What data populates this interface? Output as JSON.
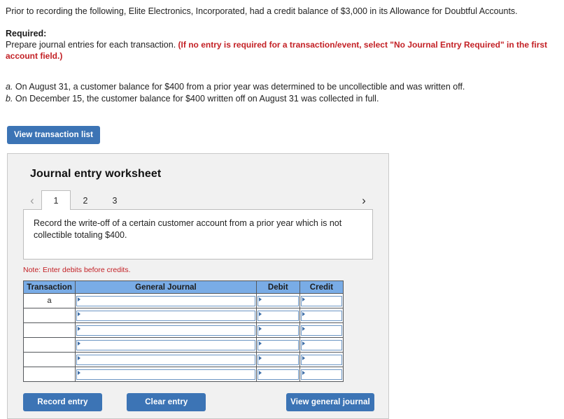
{
  "problem": {
    "intro": "Prior to recording the following, Elite Electronics, Incorporated, had a credit balance of $3,000 in its Allowance for Doubtful Accounts.",
    "required_label": "Required:",
    "required_text": "Prepare journal entries for each transaction.",
    "required_note": "(If no entry is required for a transaction/event, select \"No Journal Entry Required\" in the first account field.)",
    "transactions": [
      {
        "key": "a.",
        "text": "On August 31, a customer balance for $400 from a prior year was determined to be uncollectible and was written off."
      },
      {
        "key": "b.",
        "text": "On December 15, the customer balance for $400 written off on August 31 was collected in full."
      }
    ]
  },
  "actions": {
    "view_transaction_list": "View transaction list"
  },
  "worksheet": {
    "title": "Journal entry worksheet",
    "nav": {
      "prev_icon": "chevron-left-icon",
      "next_icon": "chevron-right-icon",
      "prev_glyph": "‹",
      "next_glyph": "›"
    },
    "tabs": [
      {
        "label": "1",
        "active": true
      },
      {
        "label": "2",
        "active": false
      },
      {
        "label": "3",
        "active": false
      }
    ],
    "instruction": "Record the write-off of a certain customer account from a prior year which is not collectible totaling $400.",
    "note": "Note: Enter debits before credits.",
    "table": {
      "headers": [
        "Transaction",
        "General Journal",
        "Debit",
        "Credit"
      ],
      "rows": [
        {
          "transaction": "a",
          "general_journal": "",
          "debit": "",
          "credit": ""
        },
        {
          "transaction": "",
          "general_journal": "",
          "debit": "",
          "credit": ""
        },
        {
          "transaction": "",
          "general_journal": "",
          "debit": "",
          "credit": ""
        },
        {
          "transaction": "",
          "general_journal": "",
          "debit": "",
          "credit": ""
        },
        {
          "transaction": "",
          "general_journal": "",
          "debit": "",
          "credit": ""
        },
        {
          "transaction": "",
          "general_journal": "",
          "debit": "",
          "credit": ""
        }
      ]
    },
    "buttons": {
      "record_entry": "Record entry",
      "clear_entry": "Clear entry",
      "view_general_journal": "View general journal"
    }
  },
  "colors": {
    "button_blue": "#3c74b5",
    "table_header_blue": "#79ace6",
    "alert_red": "#c32025",
    "panel_gray": "#f1f1f1",
    "input_border_blue": "#6c96c4"
  }
}
